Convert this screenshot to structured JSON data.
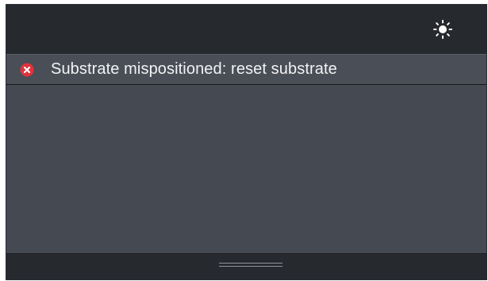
{
  "header": {
    "settings_icon": "brightness-icon"
  },
  "alert": {
    "severity": "error",
    "icon": "error-x-icon",
    "icon_color": "#e0333d",
    "message": "Substrate mispositioned: reset substrate"
  },
  "footer": {
    "handle_icon": "drag-handle"
  },
  "colors": {
    "panel": "#454952",
    "bar": "#26292e",
    "text": "#f2f3f5"
  }
}
